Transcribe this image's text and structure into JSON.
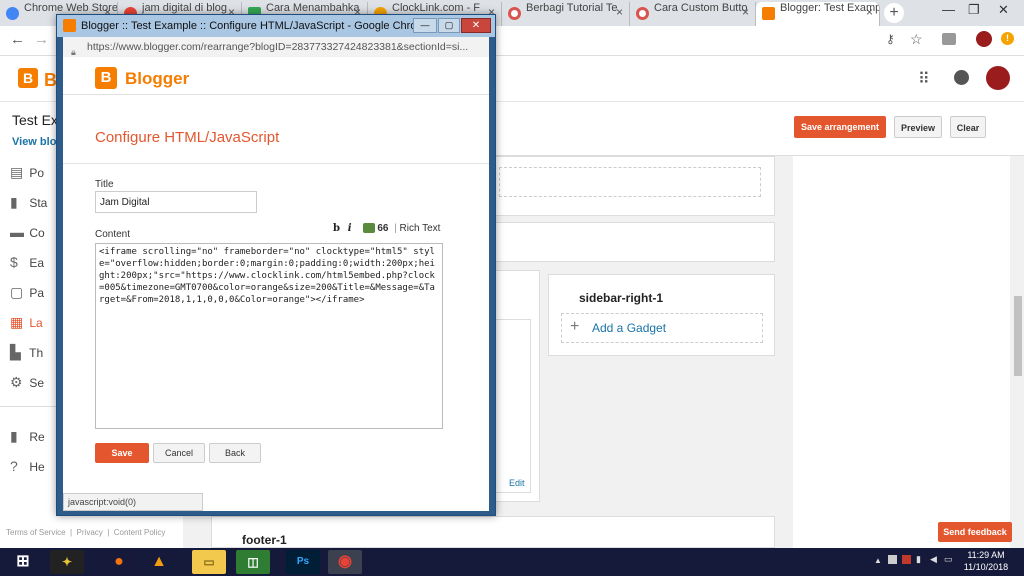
{
  "chrome": {
    "tabs": [
      {
        "title": "Chrome Web Store",
        "color": "#4285f4"
      },
      {
        "title": "jam digital di blog",
        "color": "#ea4335"
      },
      {
        "title": "Cara Menambahka",
        "color": "#34a853"
      },
      {
        "title": "ClockLink.com - F",
        "color": "#f4a300"
      },
      {
        "title": "Berbagi Tutorial Te",
        "color": "#d9534f"
      },
      {
        "title": "Cara Custom Butto",
        "color": "#d9534f"
      },
      {
        "title": "Blogger: Test Examp",
        "color": "#f57d00"
      }
    ],
    "new_tab": "+",
    "close": "×"
  },
  "blogger": {
    "brand": "Blogger",
    "blog_title": "Test Ex",
    "view_blog": "View blog",
    "nav": [
      {
        "label": "Po",
        "icon": "▤"
      },
      {
        "label": "Sta",
        "icon": "▮"
      },
      {
        "label": "Co",
        "icon": "▬"
      },
      {
        "label": "Ea",
        "icon": "$"
      },
      {
        "label": "Pa",
        "icon": "▢"
      },
      {
        "label": "La",
        "icon": "▦"
      },
      {
        "label": "Th",
        "icon": "▙"
      },
      {
        "label": "Se",
        "icon": "⚙"
      },
      {
        "label": "Re",
        "icon": "▮"
      },
      {
        "label": "He",
        "icon": "?"
      }
    ],
    "footer_links": [
      "Terms of Service",
      "Privacy",
      "Content Policy"
    ],
    "actions": {
      "save_arrangement": "Save arrangement",
      "preview": "Preview",
      "clear": "Clear"
    },
    "sidebar_right_title": "sidebar-right-1",
    "add_gadget": "Add a Gadget",
    "edit_link": "Edit",
    "footer_title": "footer-1",
    "send_feedback": "Send feedback"
  },
  "popup": {
    "window_title": "Blogger :: Test Example :: Configure HTML/JavaScript - Google Chrome",
    "url": "https://www.blogger.com/rearrange?blogID=283773327424823381&sectionId=si...",
    "brand": "Blogger",
    "heading": "Configure HTML/JavaScript",
    "title_label": "Title",
    "title_value": "Jam Digital",
    "content_label": "Content",
    "toolbar": {
      "bold": "b",
      "italic": "i",
      "quote": "66",
      "rich_text": "Rich Text"
    },
    "content_value": "<iframe scrolling=\"no\" frameborder=\"no\" clocktype=\"html5\" style=\"overflow:hidden;border:0;margin:0;padding:0;width:200px;height:200px;\"src=\"https://www.clocklink.com/html5embed.php?clock=005&timezone=GMT0700&color=orange&size=200&Title=&Message=&Target=&From=2018,1,1,0,0,0&Color=orange\"></iframe>",
    "save": "Save",
    "cancel": "Cancel",
    "back": "Back",
    "status": "javascript:void(0)"
  },
  "taskbar": {
    "time": "11:29 AM",
    "date": "11/10/2018"
  }
}
